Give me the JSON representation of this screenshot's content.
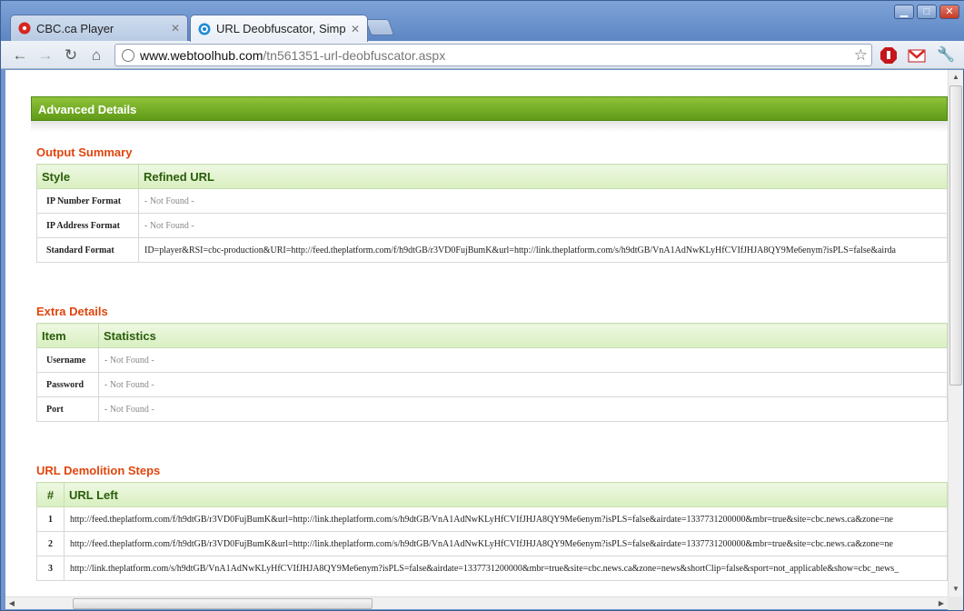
{
  "tabs": [
    {
      "title": "CBC.ca Player",
      "active": false
    },
    {
      "title": "URL Deobfuscator, Simplif",
      "active": true
    }
  ],
  "omnibox": {
    "host": "www.webtoolhub.com",
    "path": "/tn561351-url-deobfuscator.aspx"
  },
  "panel": {
    "title": "Advanced Details"
  },
  "output_summary": {
    "heading": "Output Summary",
    "columns": [
      "Style",
      "Refined URL"
    ],
    "rows": [
      {
        "key": "IP Number Format",
        "value": "- Not Found -"
      },
      {
        "key": "IP Address Format",
        "value": "- Not Found -"
      },
      {
        "key": "Standard Format",
        "value": "ID=player&RSI=cbc-production&URI=http://feed.theplatform.com/f/h9dtGB/r3VD0FujBumK&url=http://link.theplatform.com/s/h9dtGB/VnA1AdNwKLyHfCVIfJHJA8QY9Me6enym?isPLS=false&airda"
      }
    ]
  },
  "extra_details": {
    "heading": "Extra Details",
    "columns": [
      "Item",
      "Statistics"
    ],
    "rows": [
      {
        "key": "Username",
        "value": "- Not Found -"
      },
      {
        "key": "Password",
        "value": "- Not Found -"
      },
      {
        "key": "Port",
        "value": "- Not Found -"
      }
    ]
  },
  "demolition": {
    "heading": "URL Demolition Steps",
    "columns": [
      "#",
      "URL Left"
    ],
    "rows": [
      {
        "num": "1",
        "url": "http://feed.theplatform.com/f/h9dtGB/r3VD0FujBumK&url=http://link.theplatform.com/s/h9dtGB/VnA1AdNwKLyHfCVIfJHJA8QY9Me6enym?isPLS=false&airdate=1337731200000&mbr=true&site=cbc.news.ca&zone=ne"
      },
      {
        "num": "2",
        "url": "http://feed.theplatform.com/f/h9dtGB/r3VD0FujBumK&url=http://link.theplatform.com/s/h9dtGB/VnA1AdNwKLyHfCVIfJHJA8QY9Me6enym?isPLS=false&airdate=1337731200000&mbr=true&site=cbc.news.ca&zone=ne"
      },
      {
        "num": "3",
        "url": "http://link.theplatform.com/s/h9dtGB/VnA1AdNwKLyHfCVIfJHJA8QY9Me6enym?isPLS=false&airdate=1337731200000&mbr=true&site=cbc.news.ca&zone=news&shortClip=false&sport=not_applicable&show=cbc_news_"
      }
    ]
  },
  "colors": {
    "section": "#e0450d",
    "panel": "#6aa51f",
    "header_text": "#2a5d0a"
  },
  "icons": [
    "cbc-favicon",
    "webtoolhub-favicon",
    "back-icon",
    "forward-icon",
    "reload-icon",
    "home-icon",
    "globe-icon",
    "star-icon",
    "adblock-icon",
    "gmail-icon",
    "wrench-icon"
  ]
}
